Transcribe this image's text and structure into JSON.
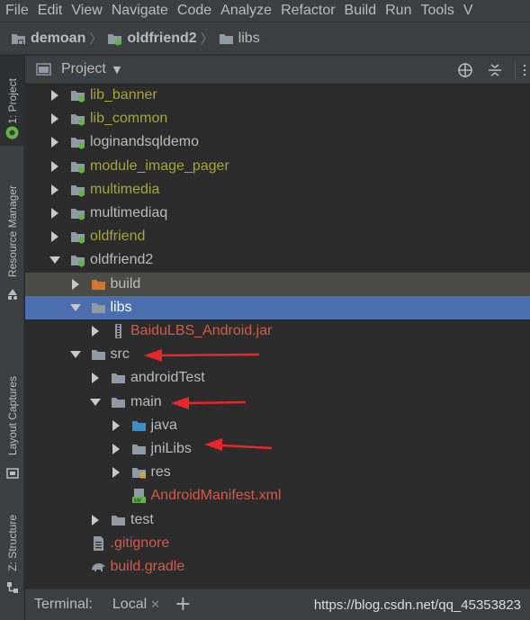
{
  "menu": [
    "File",
    "Edit",
    "View",
    "Navigate",
    "Code",
    "Analyze",
    "Refactor",
    "Build",
    "Run",
    "Tools",
    "V"
  ],
  "breadcrumb": [
    "demoan",
    "oldfriend2",
    "libs"
  ],
  "tool_strip": {
    "project": "1: Project",
    "resource_manager": "Resource Manager",
    "layout_captures": "Layout Captures",
    "structure": "Z: Structure"
  },
  "panel": {
    "title": "Project"
  },
  "tree": [
    {
      "label": "lib_banner",
      "color": "#a6a63a",
      "icon": "module-folder-icon"
    },
    {
      "label": "lib_common",
      "color": "#a6a63a",
      "icon": "module-folder-icon"
    },
    {
      "label": "loginandsqldemo",
      "color": "#bbbbbb",
      "icon": "module-folder-icon"
    },
    {
      "label": "module_image_pager",
      "color": "#a6a63a",
      "icon": "module-folder-icon"
    },
    {
      "label": "multimedia",
      "color": "#a6a63a",
      "icon": "module-folder-icon"
    },
    {
      "label": "multimediaq",
      "color": "#bbbbbb",
      "icon": "module-folder-icon"
    },
    {
      "label": "oldfriend",
      "color": "#a6a63a",
      "icon": "module-folder-icon"
    },
    {
      "label": "oldfriend2",
      "color": "#bbbbbb",
      "icon": "module-folder-icon"
    },
    {
      "label": "build",
      "color": "#bbbbbb",
      "icon": "build-folder-icon"
    },
    {
      "label": "libs",
      "color": "#ffffff",
      "icon": "folder-icon"
    },
    {
      "label": "BaiduLBS_Android.jar",
      "color": "#d35a4a",
      "icon": "jar-icon"
    },
    {
      "label": "src",
      "color": "#bbbbbb",
      "icon": "folder-icon"
    },
    {
      "label": "androidTest",
      "color": "#bbbbbb",
      "icon": "folder-icon"
    },
    {
      "label": "main",
      "color": "#bbbbbb",
      "icon": "folder-icon"
    },
    {
      "label": "java",
      "color": "#bbbbbb",
      "icon": "source-folder-icon"
    },
    {
      "label": "jniLibs",
      "color": "#bbbbbb",
      "icon": "folder-icon"
    },
    {
      "label": "res",
      "color": "#bbbbbb",
      "icon": "resource-folder-icon"
    },
    {
      "label": "AndroidManifest.xml",
      "color": "#d35a4a",
      "icon": "manifest-file-icon"
    },
    {
      "label": "test",
      "color": "#bbbbbb",
      "icon": "folder-icon"
    },
    {
      "label": ".gitignore",
      "color": "#d35a4a",
      "icon": "text-file-icon"
    },
    {
      "label": "build.gradle",
      "color": "#d35a4a",
      "icon": "gradle-icon"
    }
  ],
  "bottom": {
    "terminal": "Terminal:",
    "local": "Local",
    "url": "https://blog.csdn.net/qq_45353823"
  }
}
